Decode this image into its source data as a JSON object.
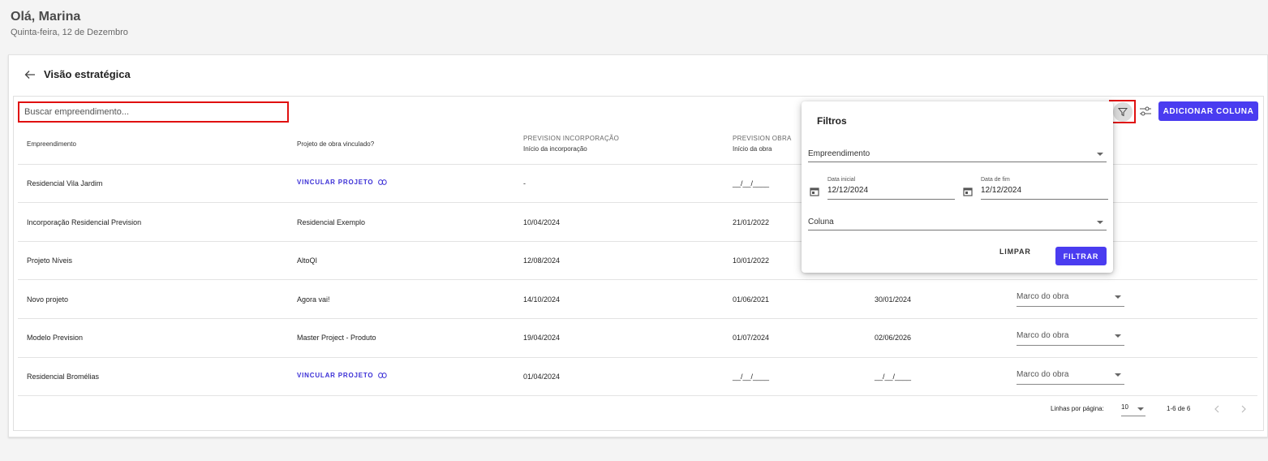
{
  "greeting": {
    "title": "Olá, Marina",
    "date": "Quinta-feira, 12 de Dezembro"
  },
  "card": {
    "title": "Visão estratégica"
  },
  "search": {
    "placeholder": "Buscar empreendimento..."
  },
  "toolbar": {
    "add_column_label": "ADICIONAR COLUNA"
  },
  "table": {
    "headers": {
      "empreendimento": "Empreendimento",
      "projeto": "Projeto de obra vinculado?",
      "inc_top": "PREVISION INCORPORAÇÃO",
      "inc_sub": "Início da incorporação",
      "obra_top": "PREVISION OBRA",
      "obra_sub": "Início da obra"
    },
    "rows": [
      {
        "empreendimento": "Residencial Vila Jardim",
        "projeto": "VINCULAR PROJETO",
        "inicio_inc": "-",
        "inicio_obra": "__/__/____",
        "fim": "",
        "marco": ""
      },
      {
        "empreendimento": "Incorporação Residencial Prevision",
        "projeto": "Residencial Exemplo",
        "inicio_inc": "10/04/2024",
        "inicio_obra": "21/01/2022",
        "fim": "",
        "marco": ""
      },
      {
        "empreendimento": "Projeto Níveis",
        "projeto": "AltoQI",
        "inicio_inc": "12/08/2024",
        "inicio_obra": "10/01/2022",
        "fim": "",
        "marco": ""
      },
      {
        "empreendimento": "Novo projeto",
        "projeto": "Agora vai!",
        "inicio_inc": "14/10/2024",
        "inicio_obra": "01/06/2021",
        "fim": "30/01/2024",
        "marco": "Marco do obra"
      },
      {
        "empreendimento": "Modelo Prevision",
        "projeto": "Master Project - Produto",
        "inicio_inc": "19/04/2024",
        "inicio_obra": "01/07/2024",
        "fim": "02/06/2026",
        "marco": "Marco do obra"
      },
      {
        "empreendimento": "Residencial Bromélias",
        "projeto": "VINCULAR PROJETO",
        "inicio_inc": "01/04/2024",
        "inicio_obra": "__/__/____",
        "fim": "__/__/____",
        "marco": "Marco do obra"
      }
    ]
  },
  "pagination": {
    "rows_label": "Linhas por página:",
    "rows_value": "10",
    "range": "1-6 de 6"
  },
  "filters": {
    "title": "Filtros",
    "empreendimento_label": "Empreendimento",
    "data_inicial_label": "Data inicial",
    "data_inicial_value": "12/12/2024",
    "data_fim_label": "Data de fim",
    "data_fim_value": "12/12/2024",
    "coluna_label": "Coluna",
    "clear_label": "LIMPAR",
    "apply_label": "FILTRAR"
  },
  "colors": {
    "accent": "#4a3cf0",
    "highlight": "#e01010"
  }
}
